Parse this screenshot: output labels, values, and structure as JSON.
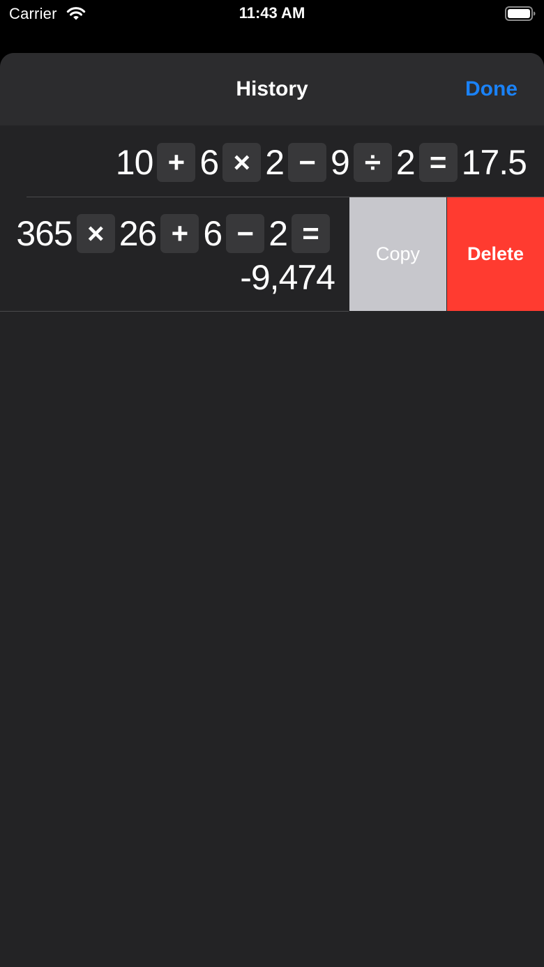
{
  "status_bar": {
    "carrier": "Carrier",
    "time": "11:43 AM",
    "wifi_icon": "wifi-icon",
    "battery_icon": "battery-icon"
  },
  "nav": {
    "title": "History",
    "done_label": "Done",
    "done_color": "#1a82f7"
  },
  "history": [
    {
      "tokens": [
        {
          "type": "num",
          "text": "10"
        },
        {
          "type": "op",
          "text": "+"
        },
        {
          "type": "num",
          "text": "6"
        },
        {
          "type": "op",
          "text": "×"
        },
        {
          "type": "num",
          "text": "2"
        },
        {
          "type": "op",
          "text": "−"
        },
        {
          "type": "num",
          "text": "9"
        },
        {
          "type": "op",
          "text": "÷"
        },
        {
          "type": "num",
          "text": "2"
        },
        {
          "type": "op",
          "text": "="
        },
        {
          "type": "num",
          "text": "17.5"
        }
      ]
    },
    {
      "tokens": [
        {
          "type": "num",
          "text": "365"
        },
        {
          "type": "op",
          "text": "×"
        },
        {
          "type": "num",
          "text": "26"
        },
        {
          "type": "op",
          "text": "+"
        },
        {
          "type": "num",
          "text": "6"
        },
        {
          "type": "op",
          "text": "−"
        },
        {
          "type": "num",
          "text": "2"
        },
        {
          "type": "op",
          "text": "="
        }
      ],
      "result": "-9,474",
      "actions": {
        "copy_label": "Copy",
        "delete_label": "Delete",
        "copy_color": "#c7c7cc",
        "delete_color": "#ff3b30"
      }
    }
  ]
}
